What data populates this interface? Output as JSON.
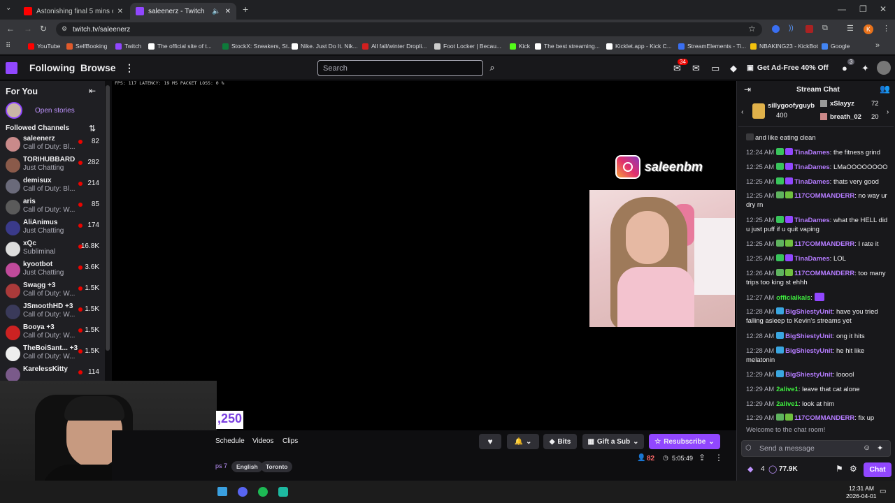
{
  "browser": {
    "tabs": [
      {
        "title": "Astonishing final 5 mins of 20…",
        "favicon_color": "#ff0000"
      },
      {
        "title": "saleenerz - Twitch",
        "favicon_color": "#9147ff"
      }
    ],
    "url": "twitch.tv/saleenerz",
    "bookmarks": [
      {
        "label": "YouTube",
        "color": "#ff0000"
      },
      {
        "label": "SelfBooking",
        "color": "#e05a2b"
      },
      {
        "label": "Twitch",
        "color": "#9147ff"
      },
      {
        "label": "The official site of t...",
        "color": "#ffffff"
      },
      {
        "label": "StockX: Sneakers, St...",
        "color": "#0e7a3a"
      },
      {
        "label": "Nike. Just Do It. Nik...",
        "color": "#ffffff"
      },
      {
        "label": "All fall/winter Dropli...",
        "color": "#d11f1f"
      },
      {
        "label": "Foot Locker | Becau...",
        "color": "#cccccc"
      },
      {
        "label": "Kick",
        "color": "#53fc18"
      },
      {
        "label": "The best streaming...",
        "color": "#ffffff"
      },
      {
        "label": "Kicklet.app - Kick C...",
        "color": "#ffffff"
      },
      {
        "label": "StreamElements - Ti...",
        "color": "#3a6ff2"
      },
      {
        "label": "NBAKING23 - KickBot",
        "color": "#f4c20d"
      },
      {
        "label": "Google",
        "color": "#4285f4"
      }
    ],
    "profile_initial": "K"
  },
  "topnav": {
    "following": "Following",
    "browse": "Browse",
    "search_placeholder": "Search",
    "notifications": "34",
    "whisper_count": "3",
    "ad_free": "Get Ad-Free 40% Off"
  },
  "sidebar": {
    "for_you": "For You",
    "open_stories": "Open stories",
    "followed_channels": "Followed Channels",
    "channels": [
      {
        "name": "saleenerz",
        "game": "Call of Duty: Bl...",
        "viewers": "82",
        "color": "#c98a8a"
      },
      {
        "name": "TORIHUBBARD",
        "game": "Just Chatting",
        "viewers": "282",
        "color": "#8a5a4a"
      },
      {
        "name": "demisux",
        "game": "Call of Duty: Bl...",
        "viewers": "214",
        "color": "#6a6a7a"
      },
      {
        "name": "aris",
        "game": "Call of Duty: W...",
        "viewers": "85",
        "color": "#5a5a5a"
      },
      {
        "name": "AliAnimus",
        "game": "Just Chatting",
        "viewers": "174",
        "color": "#3a3a8a"
      },
      {
        "name": "xQc",
        "game": "Subliminal",
        "viewers": "16.8K",
        "color": "#dddddd"
      },
      {
        "name": "kyootbot",
        "game": "Just Chatting",
        "viewers": "3.6K",
        "color": "#c04a9a"
      },
      {
        "name": "Swagg +3",
        "game": "Call of Duty: W...",
        "viewers": "1.5K",
        "color": "#aa3a3a"
      },
      {
        "name": "JSmoothHD +3",
        "game": "Call of Duty: W...",
        "viewers": "1.5K",
        "color": "#3a3a5a"
      },
      {
        "name": "Booya +3",
        "game": "Call of Duty: W...",
        "viewers": "1.5K",
        "color": "#cc2222"
      },
      {
        "name": "TheBoiSant... +3",
        "game": "Call of Duty: W...",
        "viewers": "1.5K",
        "color": "#eeeeee"
      },
      {
        "name": "KarelessKitty",
        "game": "",
        "viewers": "114",
        "color": "#7a5a8a"
      }
    ]
  },
  "video": {
    "stats": "FPS: 117  LATENCY: 19 MS  PACKET LOSS: 0 %",
    "instagram_handle": "saleenbm",
    "overlay_number": ",250"
  },
  "channel_info": {
    "tabs": [
      "Schedule",
      "Videos",
      "Clips"
    ],
    "tags": [
      "ps 7",
      "English",
      "Toronto"
    ],
    "viewer_count": "82",
    "uptime": "5:05:49",
    "bits": "Bits",
    "gift": "Gift a Sub",
    "resubscribe": "Resubscribe"
  },
  "chat": {
    "title": "Stream Chat",
    "leaderboard": [
      {
        "name": "sillygoofyguyb",
        "amount": "400"
      },
      {
        "name": "xSlayyz",
        "amount": "72"
      },
      {
        "name": "breath_02",
        "amount": "20"
      }
    ],
    "messages": [
      {
        "time": "",
        "user": "",
        "user_color": "#efeff1",
        "text": "and like eating clean",
        "badges": [
          "#3a3a3d"
        ]
      },
      {
        "time": "12:24 AM",
        "user": "TinaDames",
        "user_color": "#b57cff",
        "text": "the fitness grind",
        "badges": [
          "#39c45b",
          "#9147ff"
        ]
      },
      {
        "time": "12:25 AM",
        "user": "TinaDames",
        "user_color": "#b57cff",
        "text": "LMaOOOOOOOO",
        "badges": [
          "#39c45b",
          "#9147ff"
        ]
      },
      {
        "time": "12:25 AM",
        "user": "TinaDames",
        "user_color": "#b57cff",
        "text": "thats very good",
        "badges": [
          "#39c45b",
          "#9147ff"
        ]
      },
      {
        "time": "12:25 AM",
        "user": "117COMMANDERR",
        "user_color": "#b57cff",
        "text": "no way ur dry rn",
        "badges": [
          "#5fb35f",
          "#6fbf3f"
        ]
      },
      {
        "time": "12:25 AM",
        "user": "TinaDames",
        "user_color": "#b57cff",
        "text": "what the HELL did u just puff if u quit vaping",
        "badges": [
          "#39c45b",
          "#9147ff"
        ]
      },
      {
        "time": "12:25 AM",
        "user": "117COMMANDERR",
        "user_color": "#b57cff",
        "text": "I rate it",
        "badges": [
          "#5fb35f",
          "#6fbf3f"
        ]
      },
      {
        "time": "12:25 AM",
        "user": "TinaDames",
        "user_color": "#b57cff",
        "text": "LOL",
        "badges": [
          "#39c45b",
          "#9147ff"
        ]
      },
      {
        "time": "12:26 AM",
        "user": "117COMMANDERR",
        "user_color": "#b57cff",
        "text": "too many trips too king st ehhh",
        "badges": [
          "#5fb35f",
          "#6fbf3f"
        ]
      },
      {
        "time": "12:27 AM",
        "user": "officialkals",
        "user_color": "#3ff03f",
        "text": "",
        "badges": []
      },
      {
        "time": "12:28 AM",
        "user": "BigShiestyUnit",
        "user_color": "#b57cff",
        "text": "have you tried falling asleep to Kevin's streams yet",
        "badges": [
          "#3aa6e0"
        ]
      },
      {
        "time": "12:28 AM",
        "user": "BigShiestyUnit",
        "user_color": "#b57cff",
        "text": "ong it hits",
        "badges": [
          "#3aa6e0"
        ]
      },
      {
        "time": "12:28 AM",
        "user": "BigShiestyUnit",
        "user_color": "#b57cff",
        "text": "he hit like melatonin",
        "badges": [
          "#3aa6e0"
        ]
      },
      {
        "time": "12:29 AM",
        "user": "BigShiestyUnit",
        "user_color": "#b57cff",
        "text": "looool",
        "badges": [
          "#3aa6e0"
        ]
      },
      {
        "time": "12:29 AM",
        "user": "2alive1",
        "user_color": "#3ff03f",
        "text": "leave that cat alone",
        "badges": []
      },
      {
        "time": "12:29 AM",
        "user": "2alive1",
        "user_color": "#3ff03f",
        "text": "look at him",
        "badges": []
      },
      {
        "time": "12:29 AM",
        "user": "117COMMANDERR",
        "user_color": "#b57cff",
        "text": "fix up",
        "badges": [
          "#5fb35f",
          "#6fbf3f"
        ]
      }
    ],
    "welcome": "Welcome to the chat room!",
    "input_placeholder": "Send a message",
    "points_a": "4",
    "points_b": "77.9K",
    "chat_button": "Chat"
  },
  "system": {
    "clock_time": "12:31 AM",
    "clock_date": "2026-04-01"
  }
}
